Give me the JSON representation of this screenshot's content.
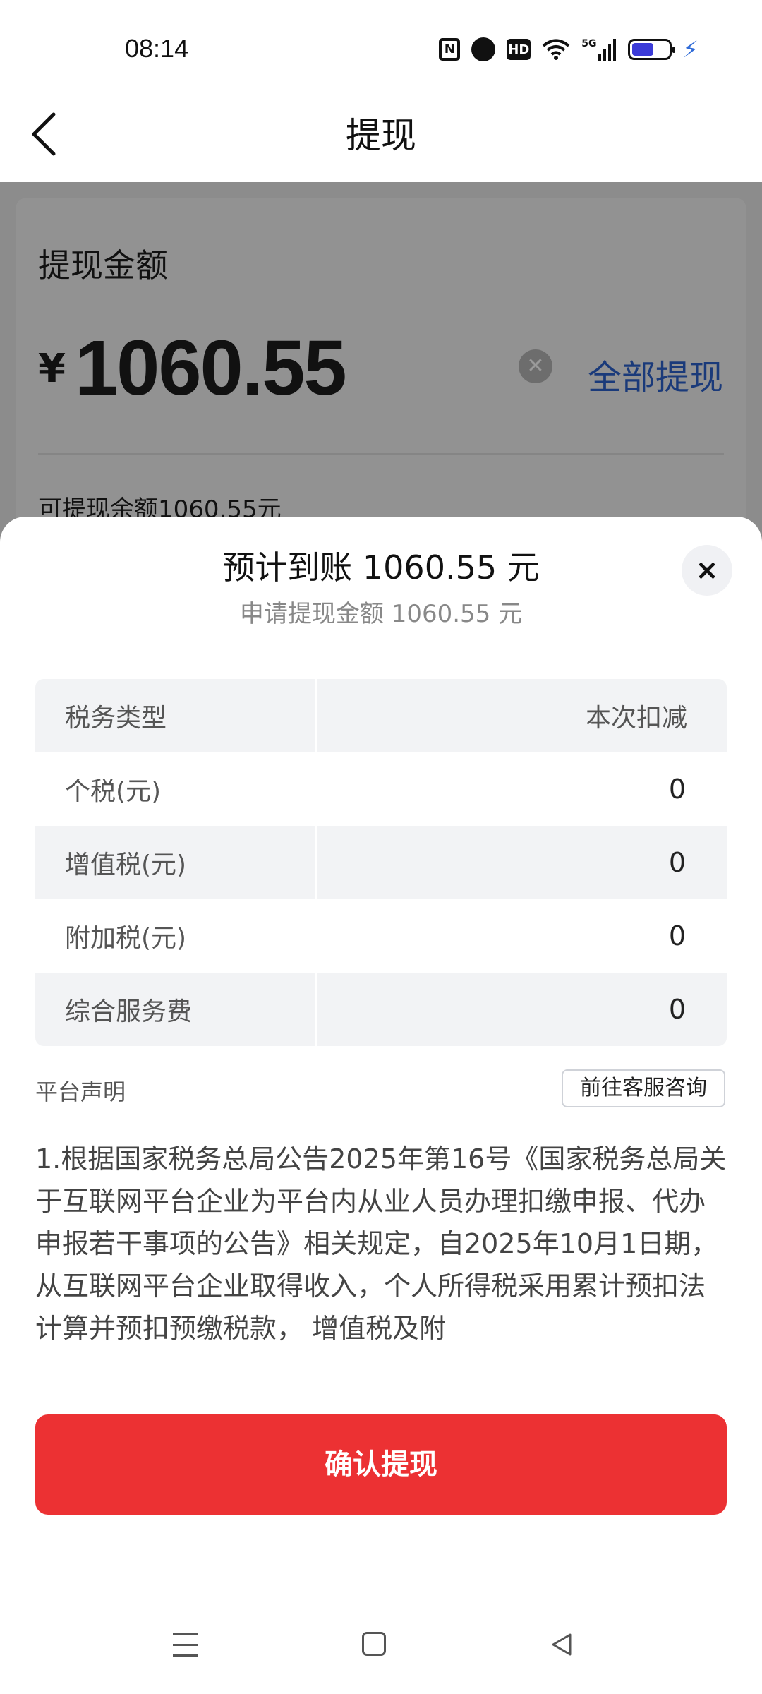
{
  "status_bar": {
    "time": "08:14",
    "icons": [
      "nfc-icon",
      "alarm-icon",
      "hd-icon",
      "wifi-icon",
      "5g-signal-icon",
      "battery-icon",
      "charging-icon"
    ],
    "hd_label": "HD",
    "nfc_label": "N",
    "network_label": "5G",
    "battery_level": 0.6
  },
  "nav": {
    "title": "提现"
  },
  "background": {
    "amount_label": "提现金额",
    "currency": "¥",
    "amount": "1060.55",
    "withdraw_all": "全部提现",
    "balance_text": "可提现余额1060.55元"
  },
  "sheet": {
    "title": "预计到账 1060.55 元",
    "subtitle": "申请提现金额 1060.55 元",
    "close_label": "×",
    "table": {
      "headers": [
        "税务类型",
        "本次扣减"
      ],
      "rows": [
        {
          "label": "个税(元)",
          "value": "0"
        },
        {
          "label": "增值税(元)",
          "value": "0"
        },
        {
          "label": "附加税(元)",
          "value": "0"
        },
        {
          "label": "综合服务费",
          "value": "0"
        }
      ]
    },
    "platform_statement": "平台声明",
    "service_button": "前往客服咨询",
    "notice": "1.根据国家税务总局公告2025年第16号《国家税务总局关于互联网平台企业为平台内从业人员办理扣缴申报、代办申报若干事项的公告》相关规定，自2025年10月1日期，从互联网平台企业取得收入，个人所得税采用累计预扣法计算并预扣预缴税款， 增值税及附",
    "confirm_button": "确认提现"
  },
  "colors": {
    "accent_red": "#ec3133",
    "link_blue": "#1a3a7a",
    "overlay_grey": "#8c8c8c"
  }
}
